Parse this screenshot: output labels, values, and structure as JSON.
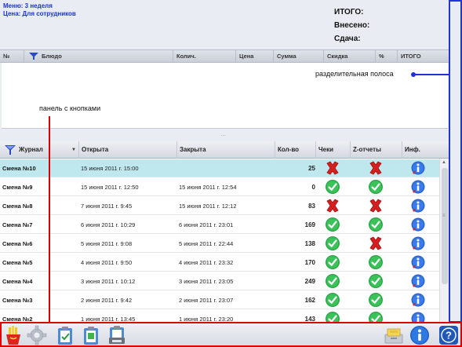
{
  "info": {
    "menu_line": "Меню: 3 неделя",
    "price_line": "Цена: Для сотрудников",
    "total_label": "ИТОГО:",
    "paid_label": "Внесено:",
    "change_label": "Сдача:"
  },
  "order_table": {
    "columns": [
      "№",
      "Блюдо",
      "Колич.",
      "Цена",
      "Сумма",
      "Скидка",
      "%",
      "ИТОГО"
    ]
  },
  "annotations": {
    "separator_bar": "разделительная полоса",
    "button_panel": "панель с кнопками"
  },
  "journal": {
    "columns": {
      "journal": "Журнал",
      "opened": "Открыта",
      "closed": "Закрыта",
      "count": "Кол-во",
      "checks": "Чеки",
      "z_reports": "Z-отчеты",
      "info": "Инф."
    },
    "rows": [
      {
        "name": "Смена №10",
        "opened": "15 июня 2011 г. 15:00",
        "closed": "",
        "count": "25",
        "checks": "cross",
        "z": "cross",
        "selected": true
      },
      {
        "name": "Смена №9",
        "opened": "15 июня 2011 г. 12:50",
        "closed": "15 июня 2011 г. 12:54",
        "count": "0",
        "checks": "check",
        "z": "check",
        "selected": false
      },
      {
        "name": "Смена №8",
        "opened": "7 июня 2011 г. 9:45",
        "closed": "15 июня 2011 г. 12:12",
        "count": "83",
        "checks": "cross",
        "z": "cross",
        "selected": false
      },
      {
        "name": "Смена №7",
        "opened": "6 июня 2011 г. 10:29",
        "closed": "6 июня 2011 г. 23:01",
        "count": "169",
        "checks": "check",
        "z": "check",
        "selected": false
      },
      {
        "name": "Смена №6",
        "opened": "5 июня 2011 г. 9:08",
        "closed": "5 июня 2011 г. 22:44",
        "count": "138",
        "checks": "check",
        "z": "cross",
        "selected": false
      },
      {
        "name": "Смена №5",
        "opened": "4 июня 2011 г. 9:50",
        "closed": "4 июня 2011 г. 23:32",
        "count": "170",
        "checks": "check",
        "z": "check",
        "selected": false
      },
      {
        "name": "Смена №4",
        "opened": "3 июня 2011 г. 10:12",
        "closed": "3 июня 2011 г. 23:05",
        "count": "249",
        "checks": "check",
        "z": "check",
        "selected": false
      },
      {
        "name": "Смена №3",
        "opened": "2 июня 2011 г. 9:42",
        "closed": "2 июня 2011 г. 23:07",
        "count": "162",
        "checks": "check",
        "z": "check",
        "selected": false
      },
      {
        "name": "Смена №2",
        "opened": "1 июня 2011 г. 13:45",
        "closed": "1 июня 2011 г. 23:20",
        "count": "143",
        "checks": "check",
        "z": "check",
        "selected": false
      }
    ]
  },
  "toolbar": {
    "left_buttons": [
      "fries-icon",
      "gear-icon",
      "clipboard-icon",
      "clipboard-green-icon",
      "clipboard-printer-icon"
    ],
    "right_buttons": [
      "cash-drawer-icon",
      "info-icon",
      "help-icon"
    ]
  },
  "colors": {
    "menu_text": "#1a34d6",
    "selected_row": "#bfe8ee",
    "separator_frame": "#2236d6",
    "panel_frame": "#e00000"
  }
}
